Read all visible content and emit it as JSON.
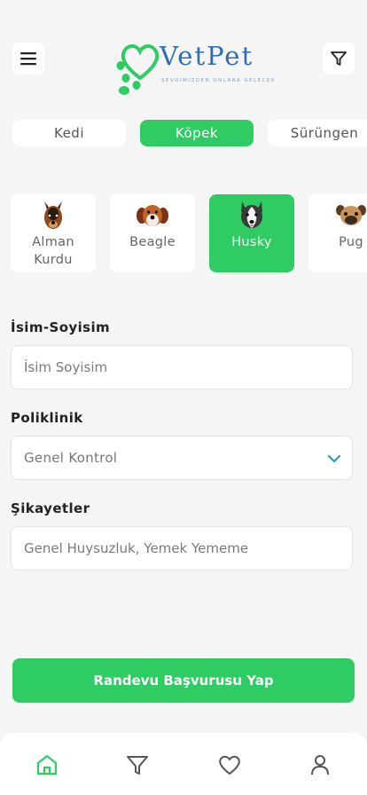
{
  "header": {
    "logo_word": "VetPet",
    "logo_tagline": "SEVGIMIZDEN ONLARA GELECEK",
    "menu_icon": "hamburger-menu-icon",
    "filter_icon": "filter-icon"
  },
  "categories": {
    "items": [
      {
        "label": "Kedi",
        "active": false
      },
      {
        "label": "Köpek",
        "active": true
      },
      {
        "label": "Sürüngen",
        "active": false
      }
    ]
  },
  "breeds": {
    "items": [
      {
        "label_line1": "Alman",
        "label_line2": "Kurdu",
        "icon": "german-shepherd-icon",
        "active": false
      },
      {
        "label_line1": "Beagle",
        "label_line2": "",
        "icon": "beagle-icon",
        "active": false
      },
      {
        "label_line1": "Husky",
        "label_line2": "",
        "icon": "husky-icon",
        "active": true
      },
      {
        "label_line1": "Pug",
        "label_line2": "",
        "icon": "pug-icon",
        "active": false
      }
    ]
  },
  "form": {
    "name_label": "İsim-Soyisim",
    "name_placeholder": "İsim Soyisim",
    "clinic_label": "Poliklinik",
    "clinic_value": "Genel Kontrol",
    "complaint_label": "Şikayetler",
    "complaint_placeholder": "Genel Huysuzluk, Yemek Yememe"
  },
  "cta": {
    "label": "Randevu Başvurusu Yap"
  },
  "colors": {
    "accent": "#2ecc63",
    "brand_blue": "#2f6db5",
    "chevron": "#1a9bb0"
  },
  "bottom_nav": {
    "items": [
      {
        "icon": "home-icon",
        "active": true
      },
      {
        "icon": "filter-icon",
        "active": false
      },
      {
        "icon": "heart-icon",
        "active": false
      },
      {
        "icon": "user-icon",
        "active": false
      }
    ]
  }
}
